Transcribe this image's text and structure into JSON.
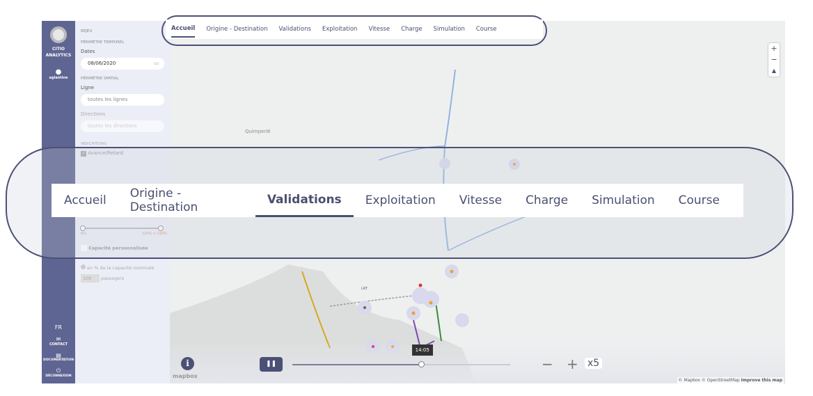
{
  "nav": {
    "brand_line1": "CITIO",
    "brand_line2": "ANALYTICS",
    "user": "eglantine",
    "lang": "FR",
    "contact": "CONTACT",
    "documentation": "DOCUMENTATION",
    "logout": "DÉCONNEXION"
  },
  "sidebar": {
    "section_replay": "REJEU",
    "section_time": "PÉRIMÈTRE TEMPOREL",
    "dates_label": "Dates",
    "date_value": "08/06/2020",
    "section_space": "PÉRIMÈTRE SPATIAL",
    "line_label": "Ligne",
    "line_value": "toutes les lignes",
    "directions_label": "Directions",
    "directions_value": "toutes les directions",
    "section_indicators": "INDICATEURS",
    "indicator_delay": "Avance/Retard",
    "range_min": "0%",
    "range_mid": "100%",
    "range_max": "> 120%",
    "custom_capacity": "Capacité personnalisée",
    "option_percent": "en % de la capacité nominale",
    "passengers_value": "100",
    "passengers_label": "passagers"
  },
  "tabs": [
    {
      "label": "Accueil",
      "active": true
    },
    {
      "label": "Origine - Destination"
    },
    {
      "label": "Validations"
    },
    {
      "label": "Exploitation"
    },
    {
      "label": "Vitesse"
    },
    {
      "label": "Charge"
    },
    {
      "label": "Simulation"
    },
    {
      "label": "Course"
    }
  ],
  "callout_tabs": [
    {
      "label": "Accueil"
    },
    {
      "label": "Origine - Destination"
    },
    {
      "label": "Validations",
      "active": true
    },
    {
      "label": "Exploitation"
    },
    {
      "label": "Vitesse"
    },
    {
      "label": "Charge"
    },
    {
      "label": "Simulation"
    },
    {
      "label": "Course"
    }
  ],
  "map": {
    "place_quimperle": "Quimperlé",
    "place_lrt": "LRT",
    "time_tooltip": "14:05",
    "progress": 0.59,
    "speed": "x5",
    "attribution": "© Mapbox © OpenStreetMap",
    "improve": "Improve this map",
    "logo": "mapbox",
    "zoom_in": "+",
    "zoom_out": "−"
  },
  "colors": {
    "nav": "#5f6592",
    "accent": "#4b5075"
  }
}
